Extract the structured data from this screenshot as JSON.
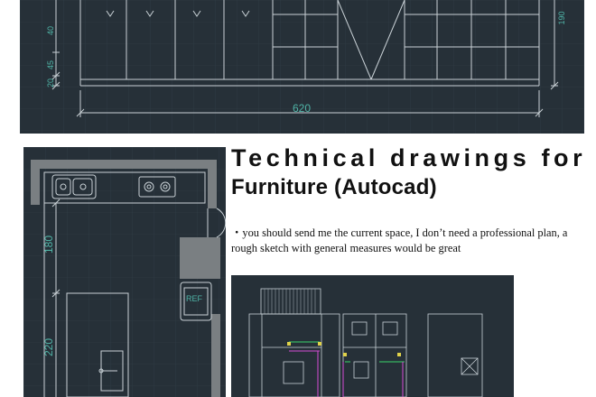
{
  "title_line1": "Technical drawings for",
  "title_line2": "Furniture (Autocad)",
  "note": "・you should send me the current  space, I don’t need a professional plan, a rough sketch with general measures would be great",
  "top_drawing": {
    "width_dim": "620",
    "height_dim": "190",
    "left_dims": [
      "40",
      "45",
      "20"
    ]
  },
  "kitchen_drawing": {
    "dim_upper": "180",
    "dim_lower": "220",
    "appliance_label": "REF"
  },
  "colors": {
    "cad_background": "#263038",
    "cad_lines": "#c9d1d6",
    "dimension_text": "#4fb3a6"
  }
}
